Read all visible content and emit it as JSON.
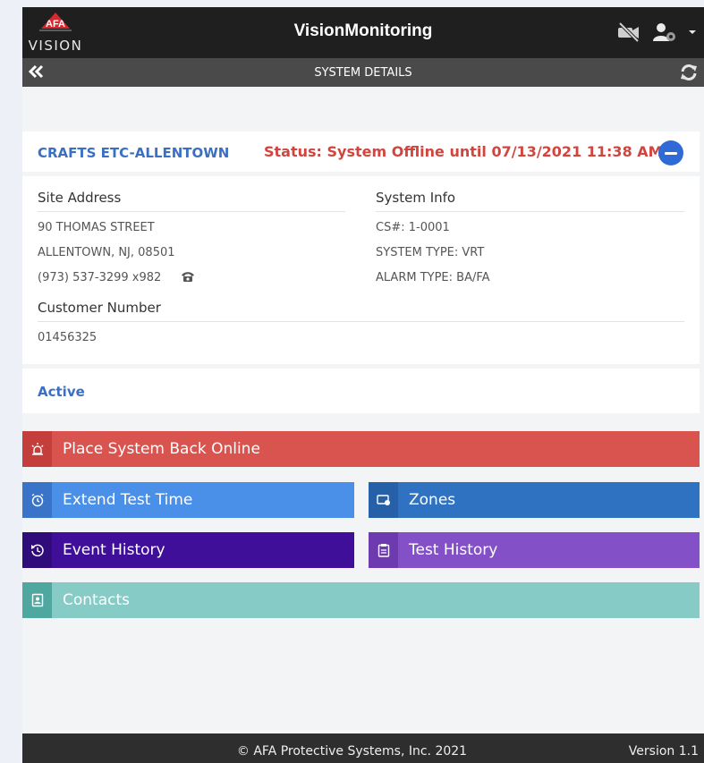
{
  "header": {
    "logo_text": "VISION",
    "logo_badge": "AFA",
    "app_title": "VisionMonitoring",
    "icons": [
      "video-off-icon",
      "user-settings-icon",
      "caret-down-icon"
    ]
  },
  "subheader": {
    "back_icon": "double-chevron-left-icon",
    "title": "SYSTEM DETAILS",
    "refresh_icon": "refresh-icon"
  },
  "system": {
    "name": "CRAFTS ETC-ALLENTOWN",
    "status": "Status: System Offline until 07/13/2021 11:38 AM",
    "collapse_icon": "minus-circle-icon"
  },
  "site_address": {
    "heading": "Site Address",
    "street": "90 THOMAS STREET",
    "city": "ALLENTOWN, NJ, 08501",
    "phone": "(973) 537-3299 x982",
    "phone_icon": "phone-icon"
  },
  "system_info": {
    "heading": "System Info",
    "cs": "CS#: 1-0001",
    "system_type": "SYSTEM TYPE: VRT",
    "alarm_type": "ALARM TYPE: BA/FA"
  },
  "customer": {
    "heading": "Customer Number",
    "number": "01456325"
  },
  "state_label": "Active",
  "actions": {
    "online": {
      "label": "Place System Back Online",
      "icon": "alarm-light-icon",
      "color": "#d9534f",
      "icon_bg": "#c43f3b"
    },
    "extend": {
      "label": "Extend Test Time",
      "icon": "alarm-clock-icon",
      "color": "#4a90e8",
      "icon_bg": "#3a74c8"
    },
    "zones": {
      "label": "Zones",
      "icon": "zones-icon",
      "color": "#2f72c2",
      "icon_bg": "#2660a8"
    },
    "events": {
      "label": "Event History",
      "icon": "history-icon",
      "color": "#3f0f9a",
      "icon_bg": "#300b7a"
    },
    "tests": {
      "label": "Test History",
      "icon": "clipboard-icon",
      "color": "#8450c8",
      "icon_bg": "#6d3ab0"
    },
    "contacts": {
      "label": "Contacts",
      "icon": "contact-card-icon",
      "color": "#86cbc5",
      "icon_bg": "#4fa89f"
    }
  },
  "footer": {
    "copyright": "© AFA Protective Systems, Inc. 2021",
    "version": "Version 1.1"
  }
}
